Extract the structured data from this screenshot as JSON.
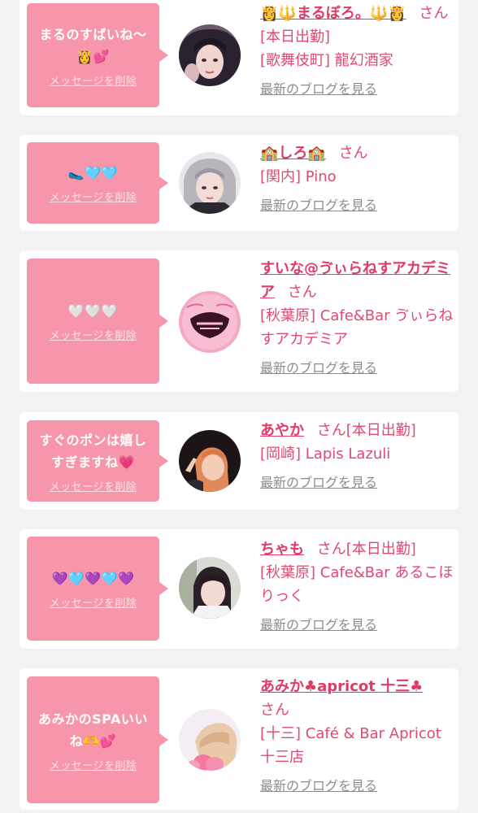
{
  "cards": [
    {
      "message": "まるのすばいね〜👸💕",
      "delete_label": "メッセージを削除",
      "name": "👸🔱まるぼろ。🔱👸",
      "honorific": "さん",
      "status": "[本日出勤]",
      "shop": "[歌舞伎町] 龍幻酒家",
      "blog_link": "最新のブログを見る",
      "avatar": "avatar-photo-1"
    },
    {
      "message": "🥿🩵🩵",
      "delete_label": "メッセージを削除",
      "name": "🏫しろ🏫",
      "honorific": "さん",
      "status": "",
      "shop": "[関内] Pino",
      "blog_link": "最新のブログを見る",
      "avatar": "avatar-photo-2"
    },
    {
      "message": "🤍🤍🤍",
      "delete_label": "メッセージを削除",
      "name": "すいな@ゔぃらねすアカデミア",
      "honorific": "さん",
      "status": "",
      "shop": "[秋葉原] Cafe&Bar ゔぃらねすアカデミア",
      "blog_link": "最新のブログを見る",
      "avatar": "avatar-logo-3"
    },
    {
      "message": "すぐのポンは嬉しすぎますね💗",
      "delete_label": "メッセージを削除",
      "name": "あやか",
      "honorific": "さん",
      "status": "[本日出勤]",
      "shop": "[岡崎] Lapis Lazuli",
      "blog_link": "最新のブログを見る",
      "avatar": "avatar-photo-4"
    },
    {
      "message": "💜🩵💜🩵💜",
      "delete_label": "メッセージを削除",
      "name": "ちゃも",
      "honorific": "さん",
      "status": "[本日出勤]",
      "shop": "[秋葉原] Cafe&Bar あるこほりっく",
      "blog_link": "最新のブログを見る",
      "avatar": "avatar-photo-5"
    },
    {
      "message": "あみかのSPAいいね🫶💕",
      "delete_label": "メッセージを削除",
      "name": "あみか♣apricot 十三♣",
      "honorific": "さん",
      "status": "",
      "shop": "[十三] Café & Bar Apricot 十三店",
      "blog_link": "最新のブログを見る",
      "avatar": "avatar-photo-6"
    }
  ],
  "colors": {
    "background": "#f2f2f2",
    "card": "#ffffff",
    "message_bubble": "#f795ab",
    "accent_text": "#e04a6e",
    "link_gray": "#8c8c8c"
  }
}
